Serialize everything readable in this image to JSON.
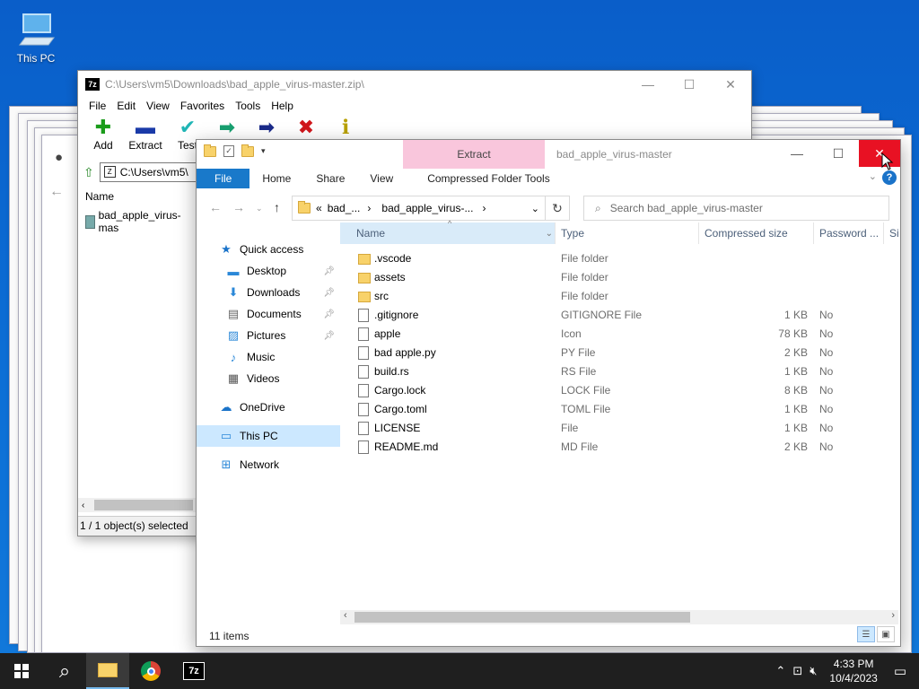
{
  "desktop": {
    "this_pc_label": "This PC"
  },
  "sevenzip": {
    "app_icon_text": "7z",
    "title": "C:\\Users\\vm5\\Downloads\\bad_apple_virus-master.zip\\",
    "menu": [
      "File",
      "Edit",
      "View",
      "Favorites",
      "Tools",
      "Help"
    ],
    "toolbar": [
      {
        "label": "Add",
        "icon": "plus-icon",
        "color": "#1b9c1b"
      },
      {
        "label": "Extract",
        "icon": "minus-icon",
        "color": "#1a3aa8"
      },
      {
        "label": "Test",
        "icon": "check-icon",
        "color": "#20b5b5"
      },
      {
        "label": "",
        "icon": "copy-arrow-icon",
        "color": "#18a070"
      },
      {
        "label": "",
        "icon": "move-arrow-icon",
        "color": "#1a2a8a"
      },
      {
        "label": "",
        "icon": "delete-icon",
        "color": "#d0161b"
      },
      {
        "label": "",
        "icon": "info-icon",
        "color": "#b8a000"
      }
    ],
    "address": "C:\\Users\\vm5\\",
    "column_name": "Name",
    "item": "bad_apple_virus-mas",
    "status": "1 / 1 object(s) selected"
  },
  "explorer": {
    "contextual_tab": "Extract",
    "title": "bad_apple_virus-master",
    "ribbon_tabs": [
      "File",
      "Home",
      "Share",
      "View",
      "Compressed Folder Tools"
    ],
    "breadcrumb": [
      "bad_...",
      "bad_apple_virus-..."
    ],
    "breadcrumb_prefix": "«",
    "search_placeholder": "Search bad_apple_virus-master",
    "nav": [
      {
        "label": "Quick access",
        "icon": "star-icon",
        "level": 0
      },
      {
        "label": "Desktop",
        "icon": "desktop-icon",
        "level": 1,
        "pinned": true
      },
      {
        "label": "Downloads",
        "icon": "download-icon",
        "level": 1,
        "pinned": true
      },
      {
        "label": "Documents",
        "icon": "document-icon",
        "level": 1,
        "pinned": true
      },
      {
        "label": "Pictures",
        "icon": "pictures-icon",
        "level": 1,
        "pinned": true
      },
      {
        "label": "Music",
        "icon": "music-icon",
        "level": 1,
        "pinned": false
      },
      {
        "label": "Videos",
        "icon": "videos-icon",
        "level": 1,
        "pinned": false
      },
      {
        "label": "OneDrive",
        "icon": "cloud-icon",
        "level": 0
      },
      {
        "label": "This PC",
        "icon": "computer-icon",
        "level": 0,
        "selected": true
      },
      {
        "label": "Network",
        "icon": "network-icon",
        "level": 0
      }
    ],
    "columns": [
      "Name",
      "Type",
      "Compressed size",
      "Password ...",
      "Si"
    ],
    "files": [
      {
        "name": ".vscode",
        "type": "File folder",
        "size": "",
        "password": "",
        "folder": true
      },
      {
        "name": "assets",
        "type": "File folder",
        "size": "",
        "password": "",
        "folder": true
      },
      {
        "name": "src",
        "type": "File folder",
        "size": "",
        "password": "",
        "folder": true
      },
      {
        "name": ".gitignore",
        "type": "GITIGNORE File",
        "size": "1 KB",
        "password": "No",
        "folder": false
      },
      {
        "name": "apple",
        "type": "Icon",
        "size": "78 KB",
        "password": "No",
        "folder": false
      },
      {
        "name": "bad apple.py",
        "type": "PY File",
        "size": "2 KB",
        "password": "No",
        "folder": false
      },
      {
        "name": "build.rs",
        "type": "RS File",
        "size": "1 KB",
        "password": "No",
        "folder": false
      },
      {
        "name": "Cargo.lock",
        "type": "LOCK File",
        "size": "8 KB",
        "password": "No",
        "folder": false
      },
      {
        "name": "Cargo.toml",
        "type": "TOML File",
        "size": "1 KB",
        "password": "No",
        "folder": false
      },
      {
        "name": "LICENSE",
        "type": "File",
        "size": "1 KB",
        "password": "No",
        "folder": false
      },
      {
        "name": "README.md",
        "type": "MD File",
        "size": "2 KB",
        "password": "No",
        "folder": false
      }
    ],
    "status": "11 items"
  },
  "taskbar": {
    "time": "4:33 PM",
    "date": "10/4/2023",
    "apps": [
      "file-explorer-icon",
      "chrome-icon",
      "7zip-icon"
    ],
    "app_7z_text": "7z"
  },
  "colors": {
    "accent": "#1979ca",
    "close_red": "#e81123",
    "extract_tab": "#f9c6dc",
    "selection": "#cce8ff"
  }
}
